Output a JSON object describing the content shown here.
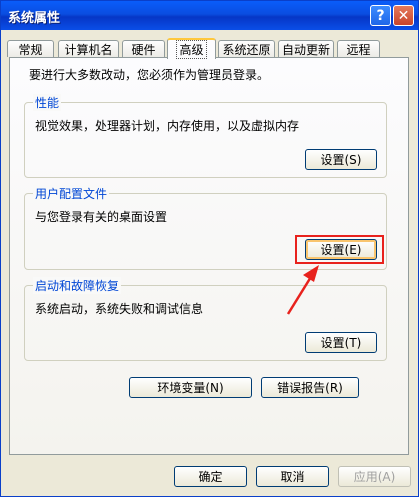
{
  "window": {
    "title": "系统属性"
  },
  "titlebar": {
    "help_glyph": "?",
    "close_glyph": "✕"
  },
  "tabs": [
    {
      "label": "常规"
    },
    {
      "label": "计算机名"
    },
    {
      "label": "硬件"
    },
    {
      "label": "高级",
      "active": true
    },
    {
      "label": "系统还原"
    },
    {
      "label": "自动更新"
    },
    {
      "label": "远程"
    }
  ],
  "panel": {
    "intro": "要进行大多数改动，您必须作为管理员登录。",
    "performance": {
      "title": "性能",
      "description": "视觉效果，处理器计划，内存使用，以及虚拟内存",
      "button": "设置(S)"
    },
    "user_profiles": {
      "title": "用户配置文件",
      "description": "与您登录有关的桌面设置",
      "button": "设置(E)"
    },
    "startup_recovery": {
      "title": "启动和故障恢复",
      "description": "系统启动，系统失败和调试信息",
      "button": "设置(T)"
    },
    "env_button": "环境变量(N)",
    "error_report_button": "错误报告(R)"
  },
  "footer": {
    "ok": "确定",
    "cancel": "取消",
    "apply": "应用(A)"
  },
  "colors": {
    "annotation": "#e8221d",
    "titlebar": "#0a4de0",
    "group_title": "#0046d5"
  }
}
